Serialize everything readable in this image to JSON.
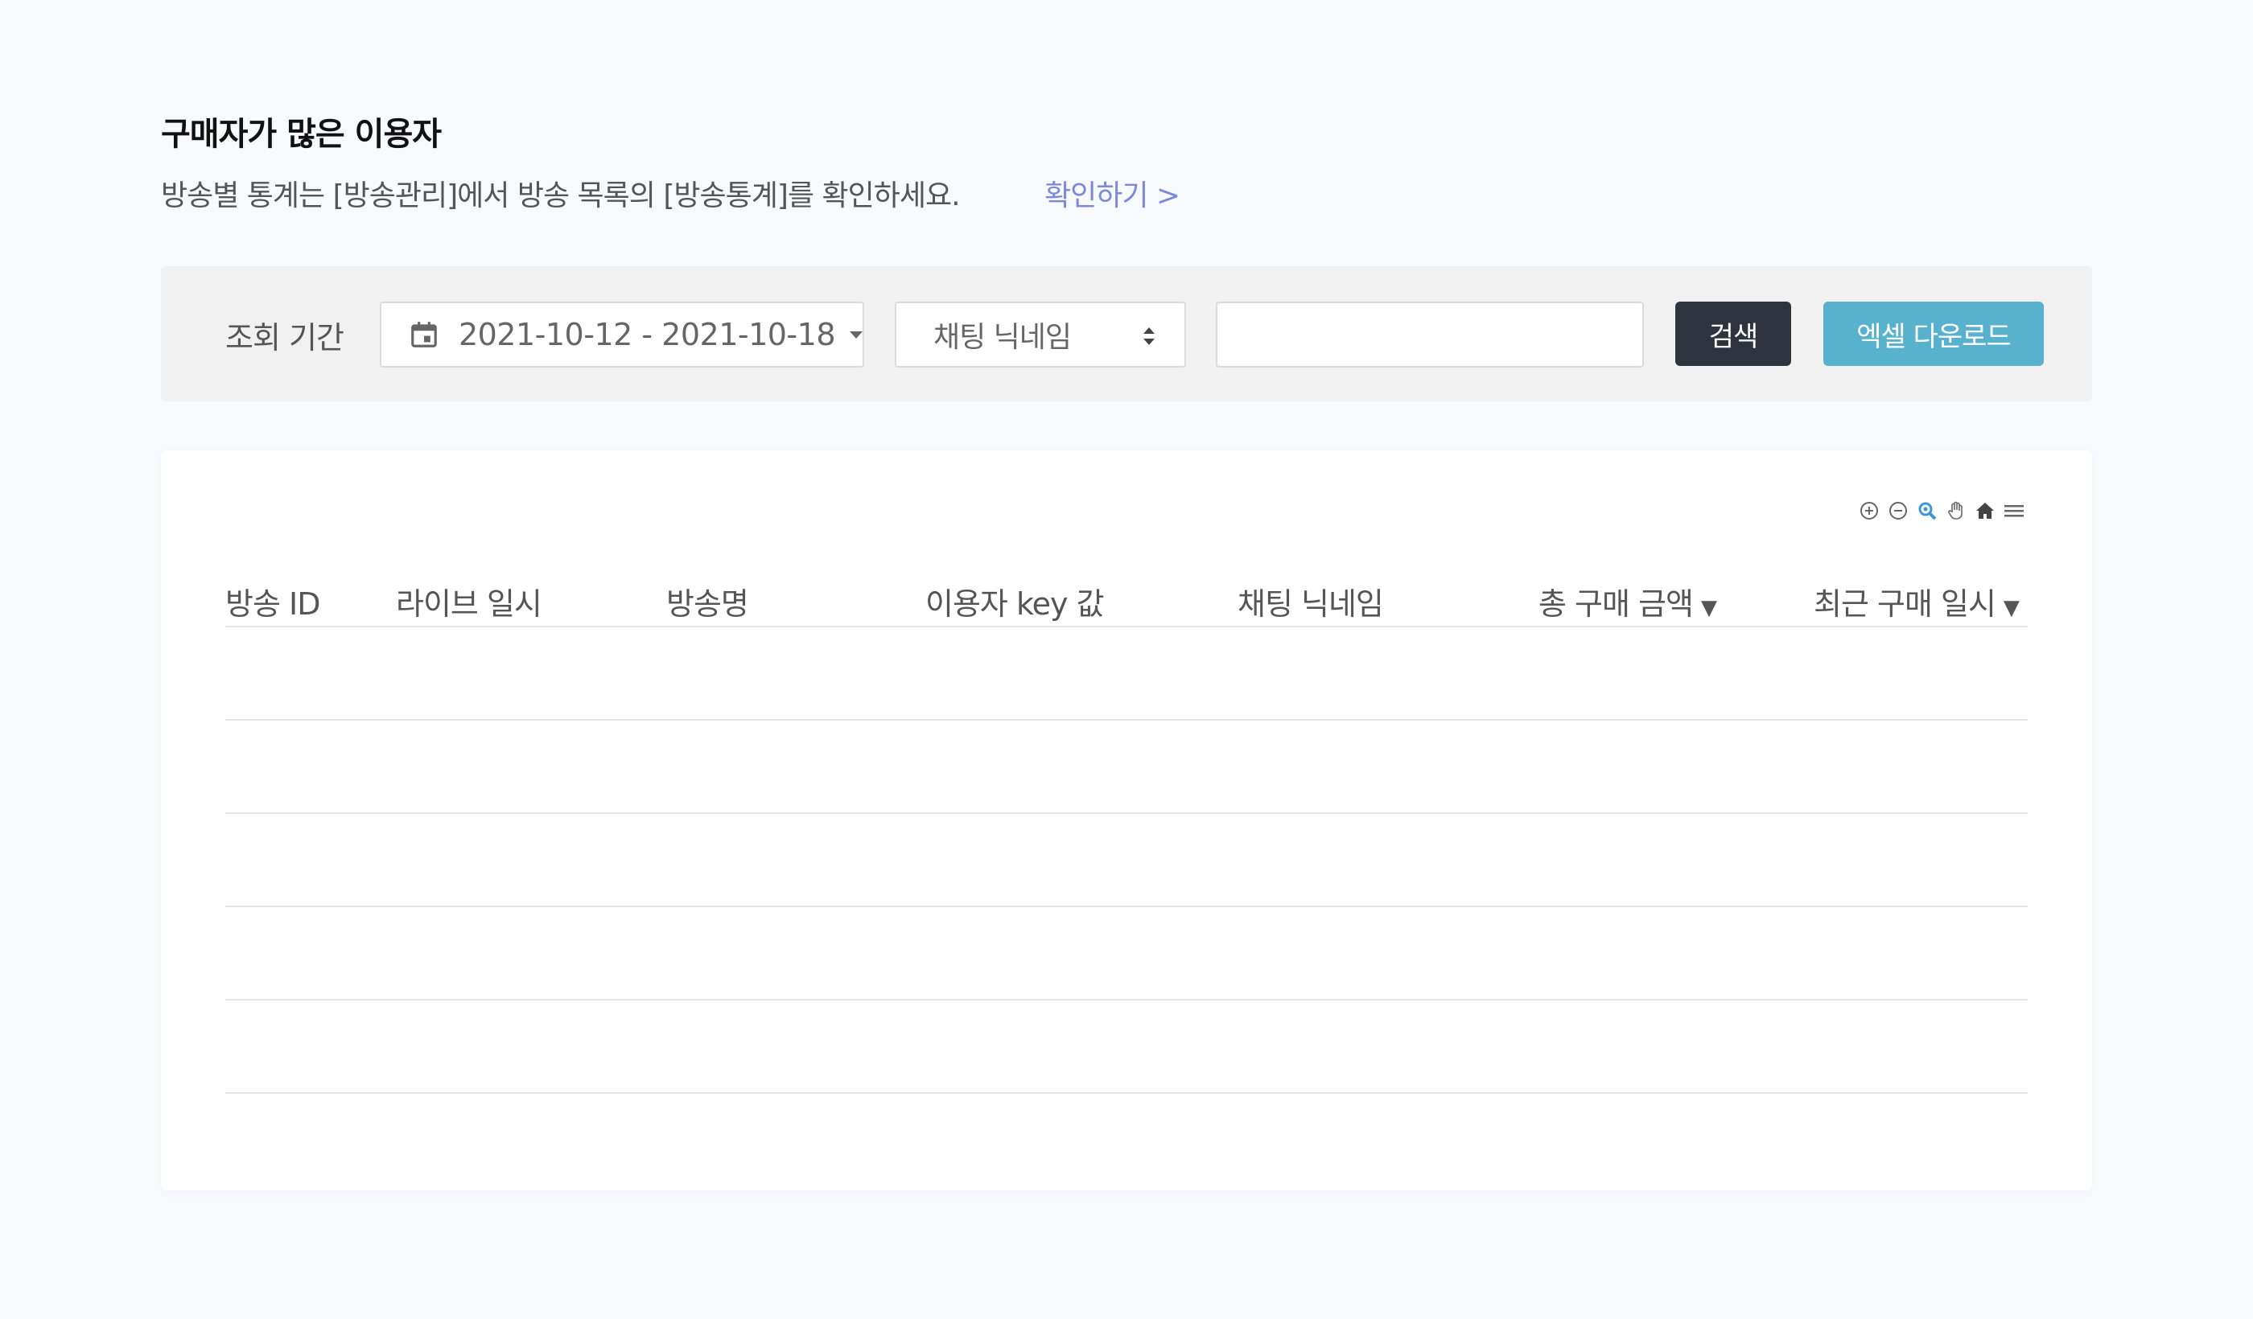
{
  "header": {
    "title": "구매자가 많은 이용자",
    "description": "방송별 통계는 [방송관리]에서 방송 목록의 [방송통계]를 확인하세요.",
    "link_label": "확인하기 >"
  },
  "filter": {
    "period_label": "조회 기간",
    "date_range": "2021-10-12 - 2021-10-18",
    "select_value": "채팅 닉네임",
    "search_value": "",
    "search_button": "검색",
    "excel_button": "엑셀 다운로드"
  },
  "chart_toolbar": {
    "icons": [
      "zoom-in-icon",
      "zoom-out-icon",
      "magnify-icon",
      "pan-hand-icon",
      "home-icon",
      "menu-icon"
    ]
  },
  "table": {
    "columns": [
      {
        "label": "방송 ID",
        "sortable": false
      },
      {
        "label": "라이브 일시",
        "sortable": false
      },
      {
        "label": "방송명",
        "sortable": false
      },
      {
        "label": "이용자 key 값",
        "sortable": false
      },
      {
        "label": "채팅 닉네임",
        "sortable": false
      },
      {
        "label": "총 구매 금액",
        "sortable": true,
        "sort_glyph": "▼"
      },
      {
        "label": "최근 구매 일시",
        "sortable": true,
        "sort_glyph": "▼"
      }
    ],
    "rows": []
  },
  "colors": {
    "link": "#7b8ad8",
    "search_button": "#2e333d",
    "excel_button": "#59b2cd",
    "filter_bg": "#f1f1f2",
    "active_tool": "#3b97d3"
  }
}
